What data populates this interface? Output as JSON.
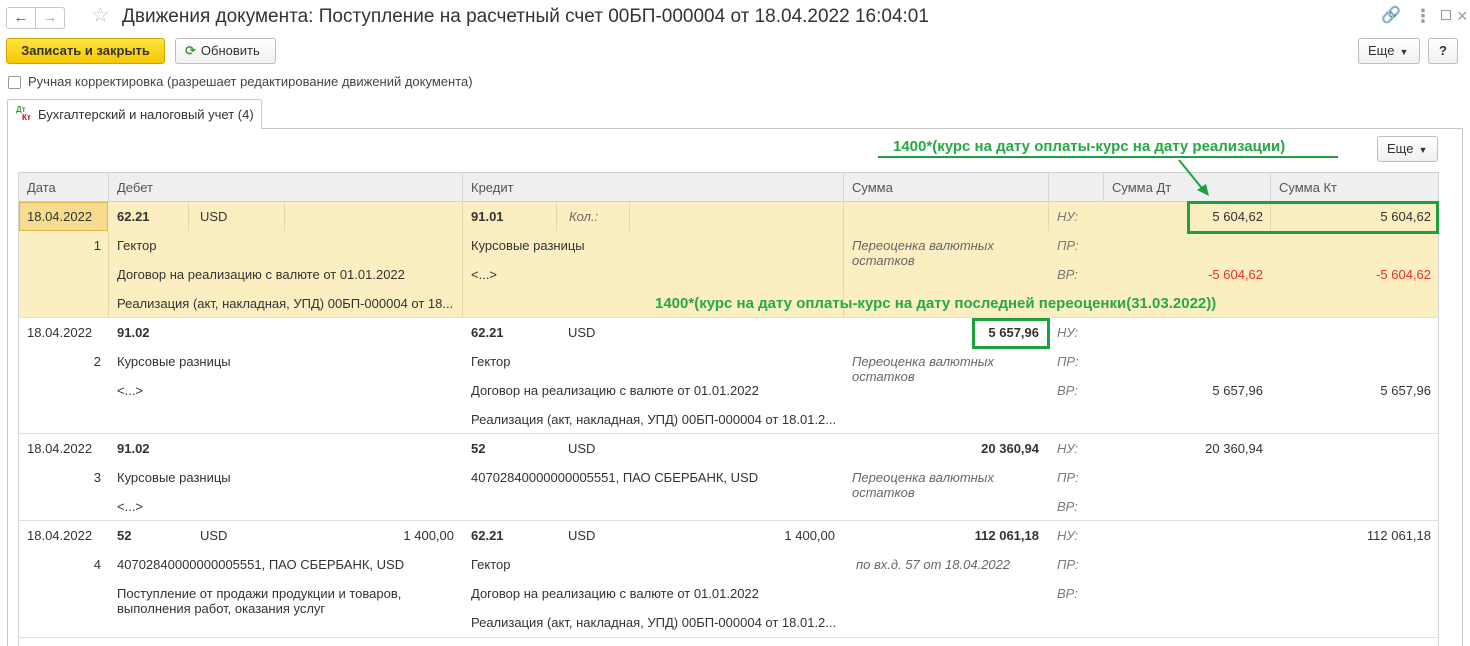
{
  "window": {
    "title": "Движения документа: Поступление на расчетный счет 00БП-000004 от 18.04.2022 16:04:01",
    "back_icon": "arrow-left",
    "forward_icon": "arrow-right",
    "star_icon": "star-outline",
    "link_icon": "link",
    "menu_icon": "vertical-ellipsis",
    "maximize_icon": "square",
    "close_icon": "x"
  },
  "toolbar": {
    "save_close_label": "Записать и закрыть",
    "refresh_label": "Обновить",
    "more_label": "Еще",
    "help_label": "?"
  },
  "manual": {
    "label": "Ручная корректировка (разрешает редактирование движений документа)",
    "checked": false
  },
  "tab": {
    "label": "Бухгалтерский и налоговый учет (4)",
    "icon_top": "Дт",
    "icon_bottom": "Кт"
  },
  "table_more_label": "Еще",
  "columns": [
    "Дата",
    "Дебет",
    "Кредит",
    "Сумма",
    "Сумма Дт",
    "Сумма Кт"
  ],
  "rows": [
    {
      "date": "18.04.2022",
      "num": "1",
      "debit_account": "62.21",
      "debit_currency": "USD",
      "debit_amount": "",
      "debit_sub": [
        "Гектор",
        "Договор на реализацию с валюте от 01.01.2022",
        "Реализация (акт, накладная, УПД) 00БП-000004 от 18..."
      ],
      "credit_account": "91.01",
      "credit_qty_label": "Кол.:",
      "credit_currency": "",
      "credit_amount": "",
      "credit_sub": [
        "Курсовые разницы",
        "<...>",
        ""
      ],
      "sum": "",
      "content": "Переоценка валютных остатков",
      "nu_label": "НУ:",
      "pr_label": "ПР:",
      "vr_label": "ВР:",
      "nu_dt": "5 604,62",
      "nu_kt": "5 604,62",
      "pr_dt": "",
      "pr_kt": "",
      "vr_dt": "-5 604,62",
      "vr_kt": "-5 604,62"
    },
    {
      "date": "18.04.2022",
      "num": "2",
      "debit_account": "91.02",
      "debit_currency": "",
      "debit_amount": "",
      "debit_sub": [
        "Курсовые разницы",
        "<...>",
        ""
      ],
      "credit_account": "62.21",
      "credit_qty_label": "",
      "credit_currency": "USD",
      "credit_amount": "",
      "credit_sub": [
        "Гектор",
        "Договор на реализацию с валюте от 01.01.2022",
        "Реализация (акт, накладная, УПД) 00БП-000004 от 18.01.2..."
      ],
      "sum": "5 657,96",
      "content": "Переоценка валютных остатков",
      "nu_label": "НУ:",
      "pr_label": "ПР:",
      "vr_label": "ВР:",
      "nu_dt": "",
      "nu_kt": "",
      "pr_dt": "",
      "pr_kt": "",
      "vr_dt": "5 657,96",
      "vr_kt": "5 657,96"
    },
    {
      "date": "18.04.2022",
      "num": "3",
      "debit_account": "91.02",
      "debit_currency": "",
      "debit_amount": "",
      "debit_sub": [
        "Курсовые разницы",
        "<...>"
      ],
      "credit_account": "52",
      "credit_qty_label": "",
      "credit_currency": "USD",
      "credit_amount": "",
      "credit_sub": [
        "40702840000000005551, ПАО СБЕРБАНК, USD"
      ],
      "sum": "20 360,94",
      "content": "Переоценка валютных остатков",
      "nu_label": "НУ:",
      "pr_label": "ПР:",
      "vr_label": "ВР:",
      "nu_dt": "20 360,94",
      "nu_kt": "",
      "pr_dt": "",
      "pr_kt": "",
      "vr_dt": "",
      "vr_kt": ""
    },
    {
      "date": "18.04.2022",
      "num": "4",
      "debit_account": "52",
      "debit_currency": "USD",
      "debit_amount": "1 400,00",
      "debit_sub": [
        "40702840000000005551, ПАО СБЕРБАНК, USD",
        "Поступление от продажи продукции и товаров, выполнения работ, оказания услуг"
      ],
      "credit_account": "62.21",
      "credit_qty_label": "",
      "credit_currency": "USD",
      "credit_amount": "1 400,00",
      "credit_sub": [
        "Гектор",
        "Договор на реализацию с валюте от 01.01.2022",
        "Реализация (акт, накладная, УПД) 00БП-000004 от 18.01.2..."
      ],
      "sum": "112 061,18",
      "content": "по вх.д. 57 от 18.04.2022",
      "nu_label": "НУ:",
      "pr_label": "ПР:",
      "vr_label": "ВР:",
      "nu_dt": "",
      "nu_kt": "112 061,18",
      "pr_dt": "",
      "pr_kt": "",
      "vr_dt": "",
      "vr_kt": ""
    }
  ],
  "annotations": {
    "top": "1400*(курс на дату оплаты-курс на дату реализации)",
    "middle": "1400*(курс на дату оплаты-курс на дату последней переоценки(31.03.2022))",
    "color": "#1fa03f"
  }
}
